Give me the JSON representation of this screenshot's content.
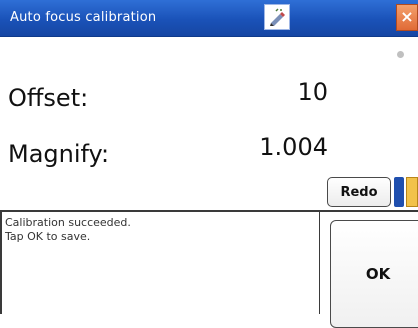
{
  "window": {
    "title": "Auto focus calibration",
    "tool_icon": "pen-tool-icon",
    "close_icon": "close-icon",
    "close_glyph": "×"
  },
  "fields": {
    "offset": {
      "label": "Offset:",
      "value": "10"
    },
    "magnify": {
      "label": "Magnify:",
      "value": "1.004"
    }
  },
  "buttons": {
    "redo": "Redo",
    "ok": "OK"
  },
  "message": {
    "line1": "Calibration succeeded.",
    "line2": "Tap OK to save."
  }
}
